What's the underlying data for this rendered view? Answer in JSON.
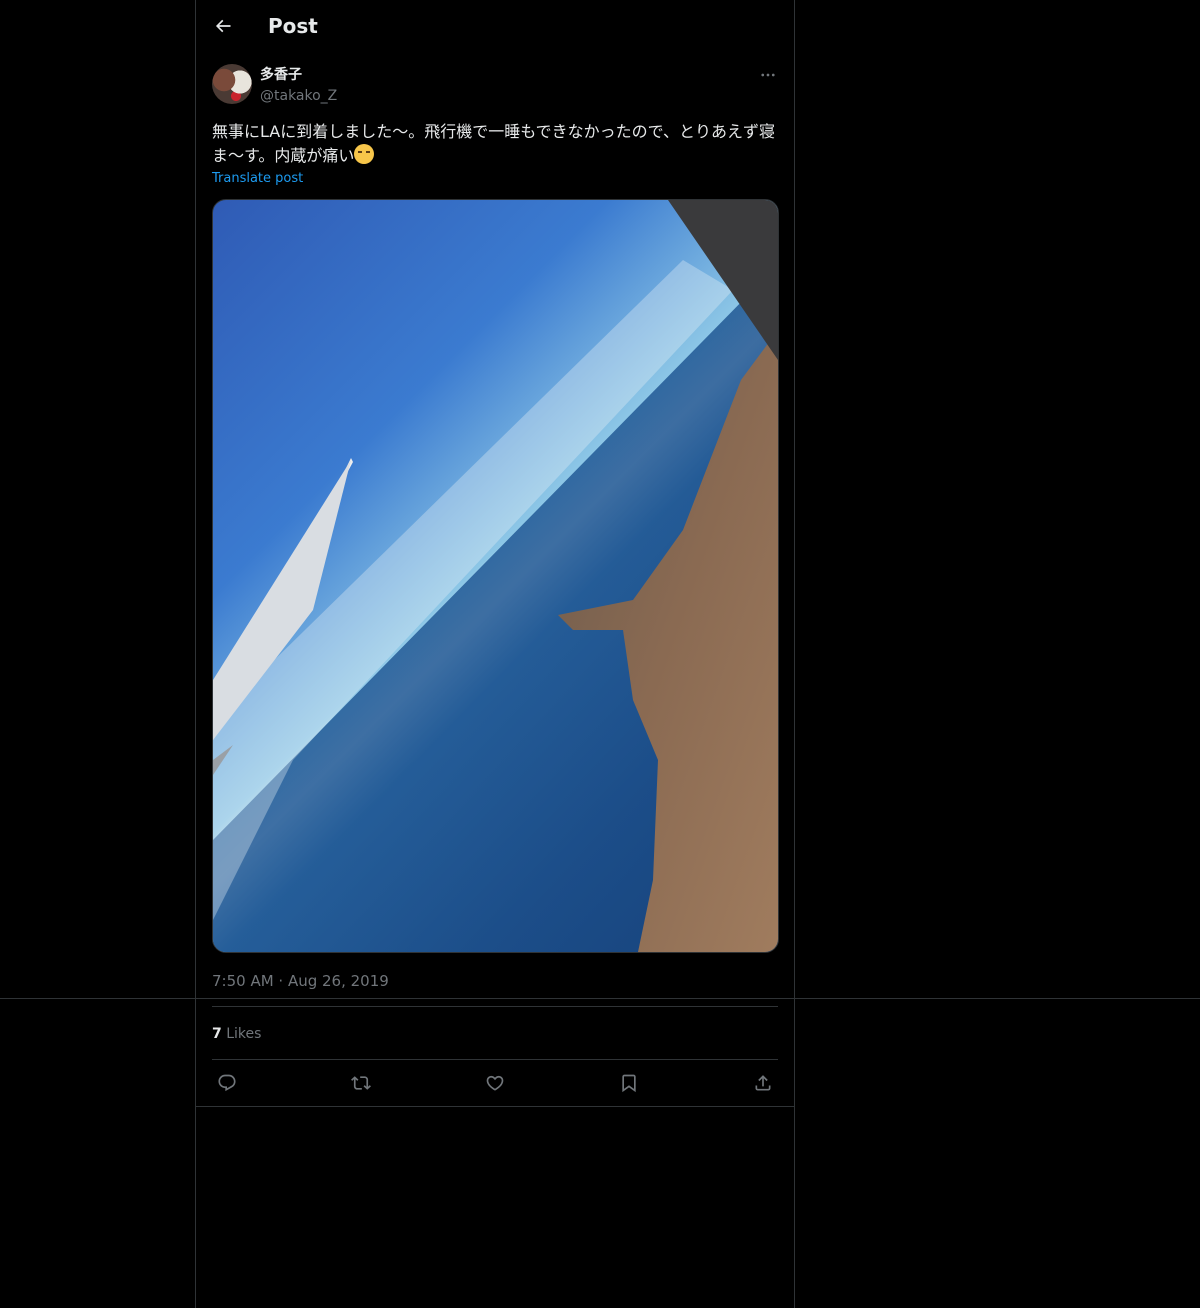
{
  "header": {
    "title": "Post",
    "back_icon": "arrow-left-icon"
  },
  "author": {
    "display_name": "多香子",
    "handle": "@takako_Z"
  },
  "post": {
    "text": "無事にLAに到着しました〜。飛行機で一睡もできなかったので、とりあえず寝ま〜す。内蔵が痛い",
    "emoji": "loudly-crying-face-icon",
    "translate_label": "Translate post",
    "timestamp": "7:50 AM · Aug 26, 2019"
  },
  "engagement": {
    "likes_count": "7",
    "likes_label": "Likes"
  },
  "actions": {
    "reply": "reply-icon",
    "repost": "repost-icon",
    "like": "heart-icon",
    "bookmark": "bookmark-icon",
    "share": "share-icon"
  },
  "colors": {
    "background": "#000000",
    "text_primary": "#e7e9ea",
    "text_secondary": "#71767b",
    "link": "#1d9bf0",
    "border": "#2f3336"
  }
}
